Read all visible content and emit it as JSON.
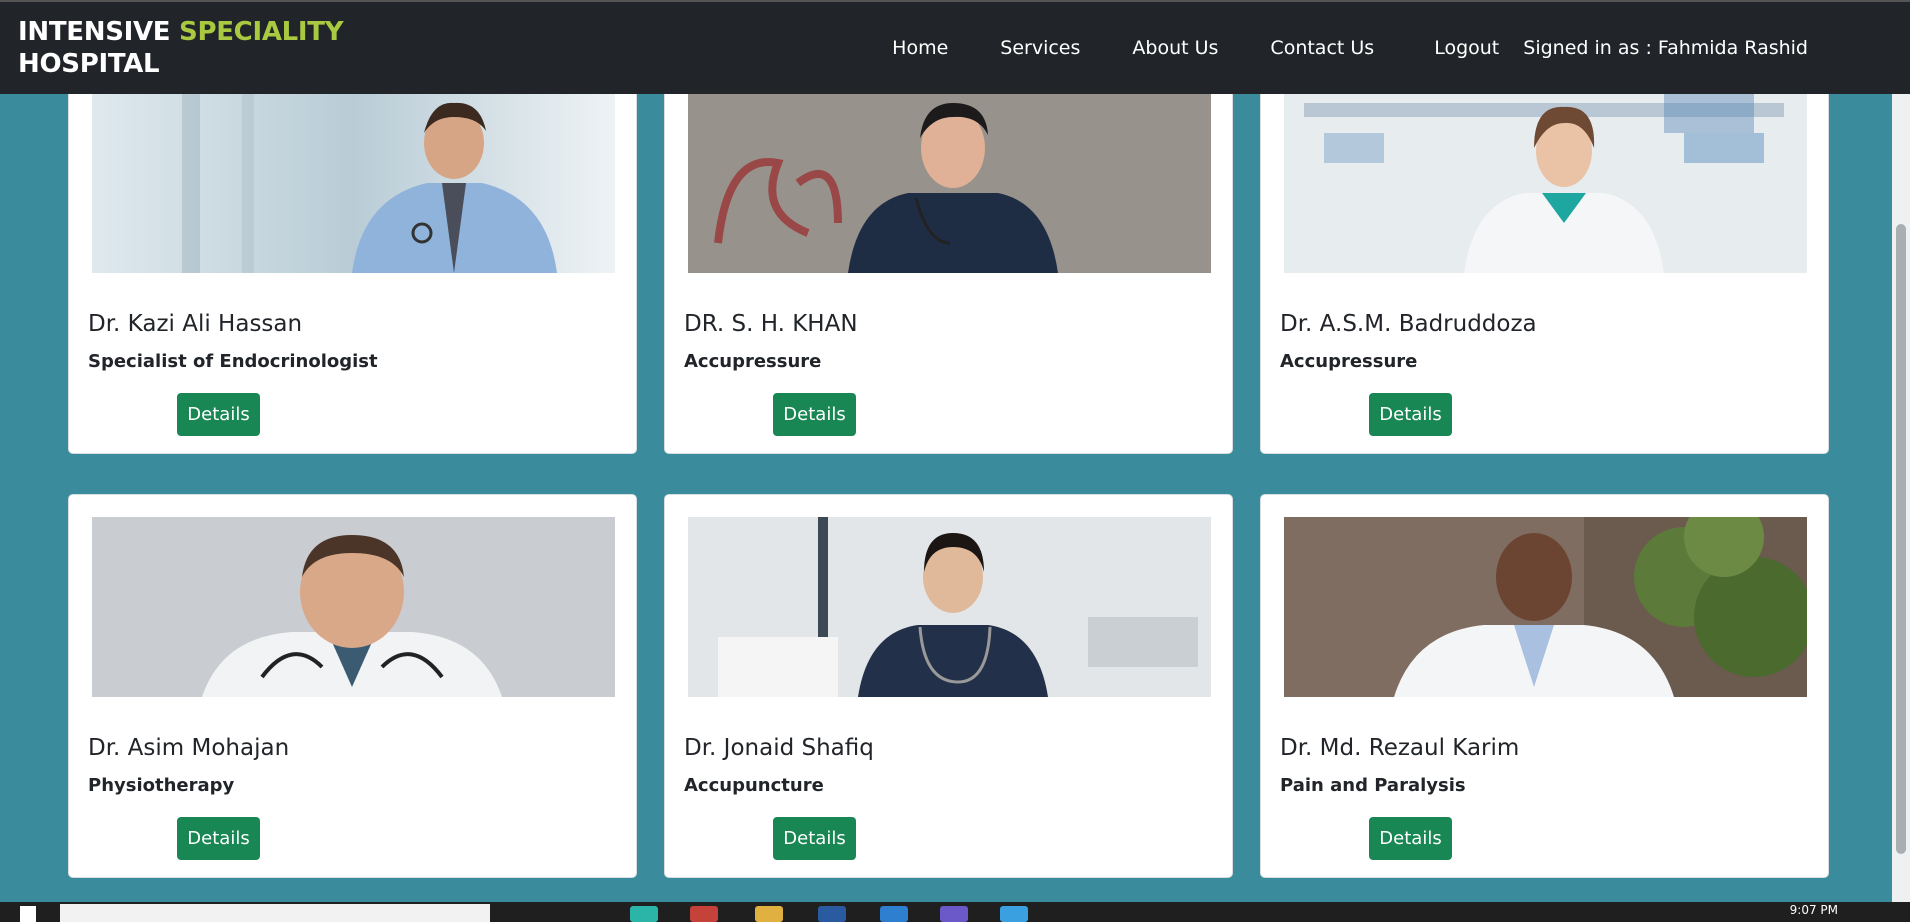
{
  "header": {
    "brand_part1": "INTENSIVE ",
    "brand_part2": "SPECIALITY",
    "brand_part3": "HOSPITAL",
    "accent_color": "#a8c940",
    "nav": [
      "Home",
      "Services",
      "About Us",
      "Contact Us"
    ],
    "logout": "Logout",
    "signed_in": "Signed in as : Fahmida Rashid"
  },
  "doctors": [
    {
      "name": "Dr. Kazi Ali Hassan",
      "specialty": "Specialist of Endocrinologist",
      "button": "Details"
    },
    {
      "name": "DR. S. H. KHAN",
      "specialty": "Accupressure",
      "button": "Details"
    },
    {
      "name": "Dr. A.S.M. Badruddoza",
      "specialty": "Accupressure",
      "button": "Details"
    },
    {
      "name": "Dr. Asim Mohajan",
      "specialty": "Physiotherapy",
      "button": "Details"
    },
    {
      "name": "Dr. Jonaid Shafiq",
      "specialty": "Accupuncture",
      "button": "Details"
    },
    {
      "name": "Dr. Md. Rezaul Karim",
      "specialty": "Pain and Paralysis",
      "button": "Details"
    }
  ],
  "taskbar": {
    "clock": "9:07 PM"
  },
  "colors": {
    "page_background": "#3a8c9c",
    "navbar": "#212529",
    "details_button": "#198754"
  }
}
